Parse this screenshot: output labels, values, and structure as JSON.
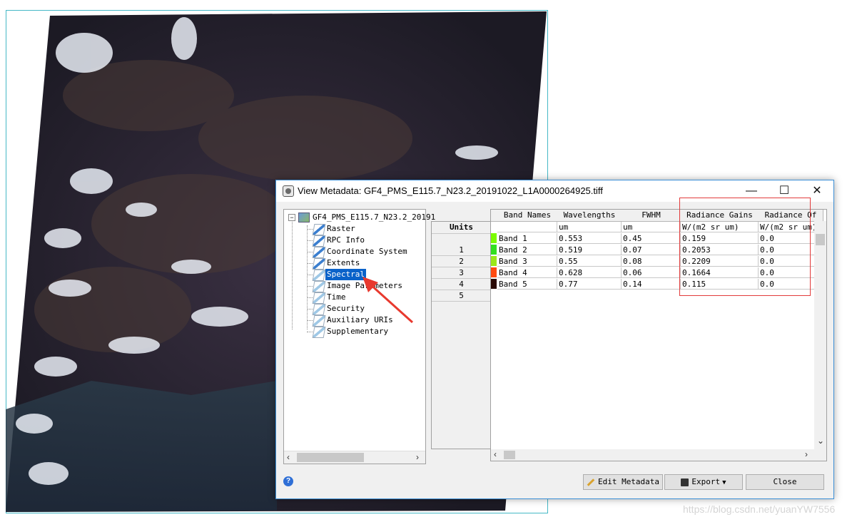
{
  "viewer": {
    "description_icon": "satellite-image"
  },
  "dialog": {
    "title": "View Metadata: GF4_PMS_E115.7_N23.2_20191022_L1A0000264925.tiff",
    "window_controls": {
      "minimize": "—",
      "maximize": "☐",
      "close": "✕"
    }
  },
  "tree": {
    "root": "GF4_PMS_E115.7_N23.2_20191",
    "items": [
      {
        "label": "Raster"
      },
      {
        "label": "RPC Info"
      },
      {
        "label": "Coordinate System"
      },
      {
        "label": "Extents"
      },
      {
        "label": "Spectral"
      },
      {
        "label": "Image Parameters"
      },
      {
        "label": "Time"
      },
      {
        "label": "Security"
      },
      {
        "label": "Auxiliary URIs"
      },
      {
        "label": "Supplementary"
      }
    ],
    "selected": "Spectral"
  },
  "units_column": {
    "header": "Units",
    "rows": [
      "1",
      "2",
      "3",
      "4",
      "5"
    ]
  },
  "table": {
    "columns": [
      "Band Names",
      "Wavelengths",
      "FWHM",
      "Radiance Gains",
      "Radiance Of"
    ],
    "units_row": [
      "",
      "um",
      "um",
      "W/(m2 sr um)",
      "W/(m2 sr um)"
    ],
    "rows": [
      {
        "color": "#7cfc00",
        "cells": [
          "Band 1",
          "0.553",
          "0.45",
          "0.159",
          "0.0"
        ]
      },
      {
        "color": "#32e020",
        "cells": [
          "Band 2",
          "0.519",
          "0.07",
          "0.2053",
          "0.0"
        ]
      },
      {
        "color": "#9ae81a",
        "cells": [
          "Band 3",
          "0.55",
          "0.08",
          "0.2209",
          "0.0"
        ]
      },
      {
        "color": "#ff4a10",
        "cells": [
          "Band 4",
          "0.628",
          "0.06",
          "0.1664",
          "0.0"
        ]
      },
      {
        "color": "#2a0a05",
        "cells": [
          "Band 5",
          "0.77",
          "0.14",
          "0.115",
          "0.0"
        ]
      }
    ]
  },
  "buttons": {
    "edit_metadata": "Edit Metadata",
    "export": "Export",
    "close": "Close"
  },
  "help": "?",
  "watermark": "https://blog.csdn.net/yuanYW7556"
}
